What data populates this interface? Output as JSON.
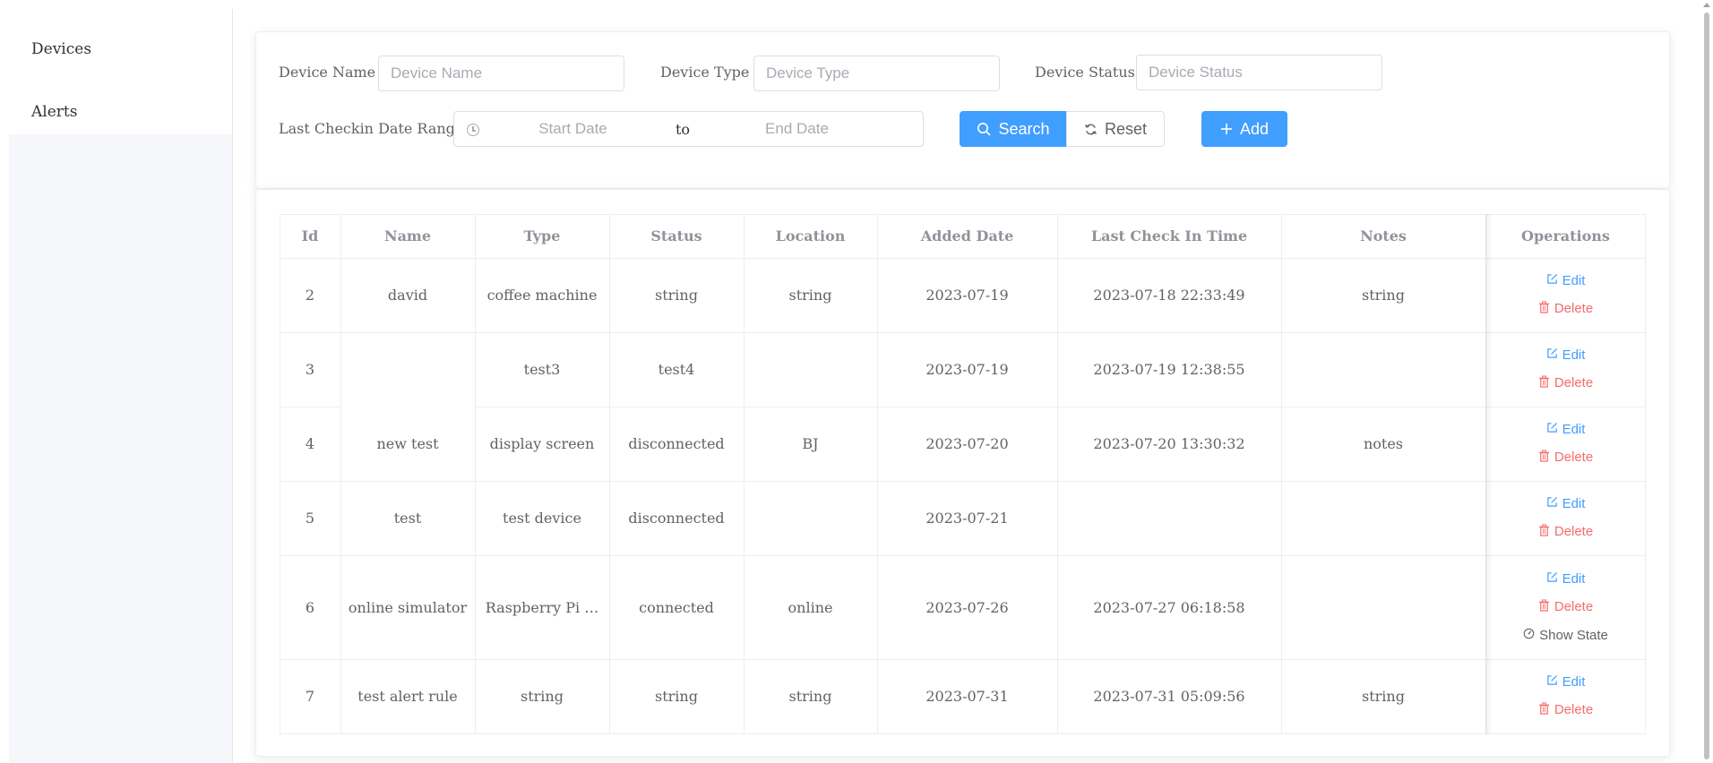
{
  "sidebar": {
    "items": [
      {
        "label": "Devices"
      },
      {
        "label": "Alerts"
      }
    ]
  },
  "search": {
    "device_name": {
      "label": "Device Name",
      "placeholder": "Device Name",
      "value": ""
    },
    "device_type": {
      "label": "Device Type",
      "placeholder": "Device Type",
      "value": ""
    },
    "device_status": {
      "label": "Device Status",
      "placeholder": "Device Status",
      "value": ""
    },
    "date_range": {
      "label": "Last Checkin Date Range",
      "start_placeholder": "Start Date",
      "separator": "to",
      "end_placeholder": "End Date"
    },
    "search_button": "Search",
    "reset_button": "Reset",
    "add_button": "Add"
  },
  "table": {
    "headers": [
      "Id",
      "Name",
      "Type",
      "Status",
      "Location",
      "Added Date",
      "Last Check In Time",
      "Notes",
      "Operations"
    ],
    "rows": [
      {
        "id": "2",
        "name": "david",
        "type": "coffee machine",
        "status": "string",
        "location": "string",
        "added": "2023-07-19",
        "last_checkin": "2023-07-18 22:33:49",
        "notes": "string"
      },
      {
        "id": "3",
        "name": "",
        "type": "test3",
        "status": "test4",
        "location": "",
        "added": "2023-07-19",
        "last_checkin": "2023-07-19 12:38:55",
        "notes": ""
      },
      {
        "id": "4",
        "name": "new test",
        "type": "display screen",
        "status": "disconnected",
        "location": "BJ",
        "added": "2023-07-20",
        "last_checkin": "2023-07-20 13:30:32",
        "notes": "notes"
      },
      {
        "id": "5",
        "name": "test",
        "type": "test device",
        "status": "disconnected",
        "location": "",
        "added": "2023-07-21",
        "last_checkin": "",
        "notes": ""
      },
      {
        "id": "6",
        "name": "online simulator",
        "type": "Raspberry Pi …",
        "status": "connected",
        "location": "online",
        "added": "2023-07-26",
        "last_checkin": "2023-07-27 06:18:58",
        "notes": ""
      },
      {
        "id": "7",
        "name": "test alert rule",
        "type": "string",
        "status": "string",
        "location": "string",
        "added": "2023-07-31",
        "last_checkin": "2023-07-31 05:09:56",
        "notes": "string"
      }
    ],
    "ops": {
      "edit": "Edit",
      "delete": "Delete",
      "show_state": "Show State"
    }
  },
  "colors": {
    "primary": "#409eff",
    "danger": "#f56c6c",
    "sidebar_bg": "#f5f7fa"
  }
}
